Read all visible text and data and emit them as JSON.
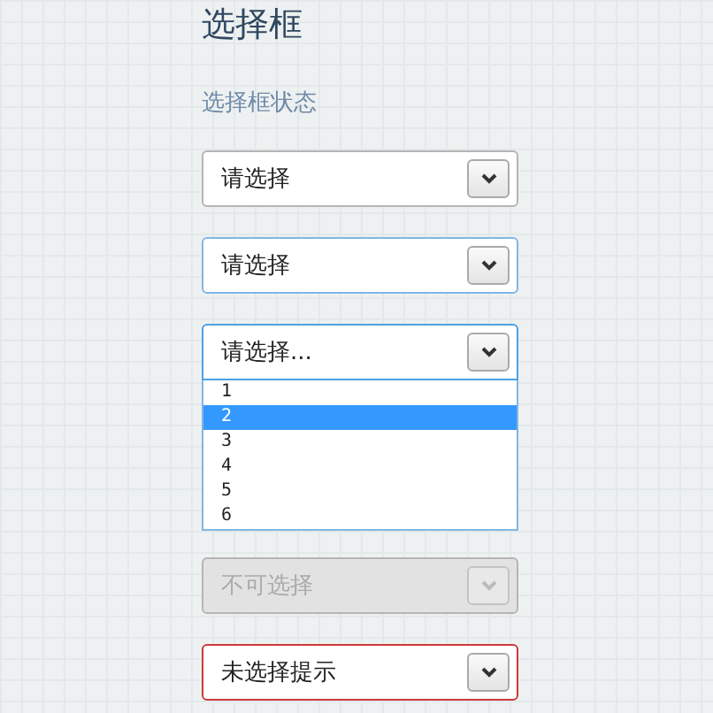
{
  "title": "选择框",
  "subtitle": "选择框状态",
  "selects": [
    {
      "kind": "normal",
      "value": "请选择",
      "expanded": false,
      "disabled": false
    },
    {
      "kind": "hover",
      "value": "请选择",
      "expanded": false,
      "disabled": false
    },
    {
      "kind": "focus",
      "value": "请选择...",
      "expanded": true,
      "disabled": false,
      "options": [
        {
          "label": "1",
          "selected": false
        },
        {
          "label": "2",
          "selected": true
        },
        {
          "label": "3",
          "selected": false
        },
        {
          "label": "4",
          "selected": false
        },
        {
          "label": "5",
          "selected": false
        },
        {
          "label": "6",
          "selected": false
        }
      ]
    },
    {
      "kind": "normal",
      "value": "不可选择",
      "expanded": false,
      "disabled": true
    },
    {
      "kind": "error",
      "value": "未选择提示",
      "expanded": false,
      "disabled": false
    }
  ]
}
